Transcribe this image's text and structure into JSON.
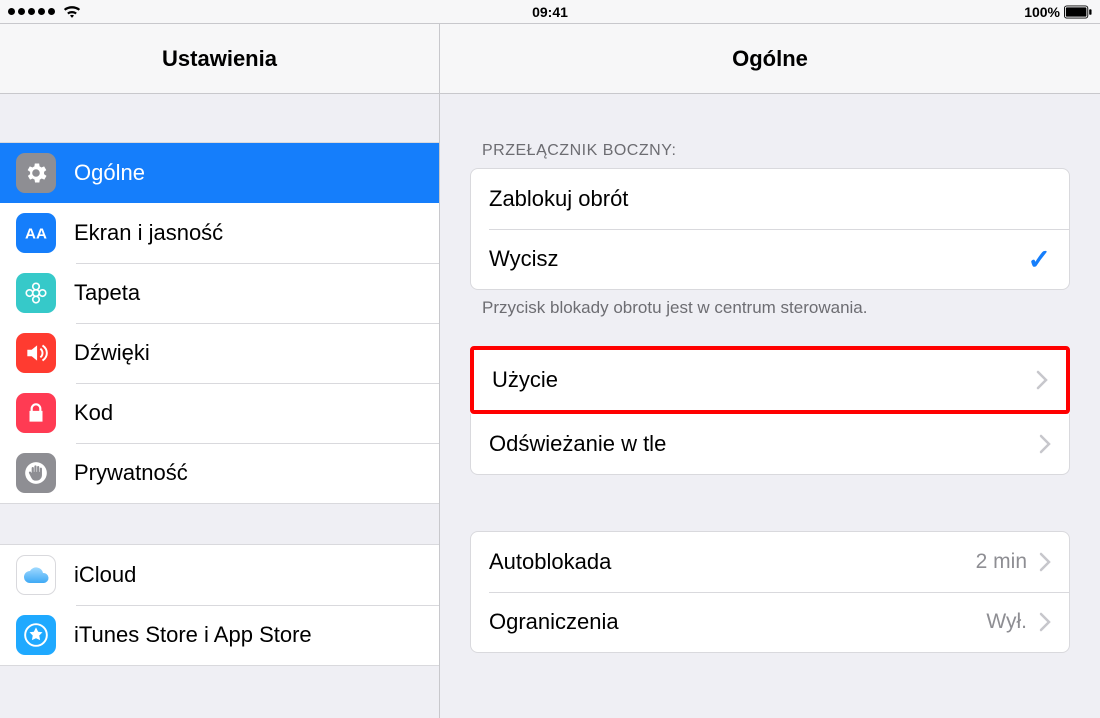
{
  "status": {
    "time": "09:41",
    "battery_pct": "100%"
  },
  "sidebar": {
    "title": "Ustawienia",
    "groups": [
      {
        "items": [
          {
            "label": "Ogólne",
            "icon": "gear",
            "icon_bg": "#8e8e93",
            "selected": true
          },
          {
            "label": "Ekran i jasność",
            "icon": "aa",
            "icon_bg": "#157efb"
          },
          {
            "label": "Tapeta",
            "icon": "flower",
            "icon_bg": "#36c9c9"
          },
          {
            "label": "Dźwięki",
            "icon": "speaker",
            "icon_bg": "#ff3b30"
          },
          {
            "label": "Kod",
            "icon": "lock",
            "icon_bg": "#ff3b53"
          },
          {
            "label": "Prywatność",
            "icon": "hand",
            "icon_bg": "#8e8e93"
          }
        ]
      },
      {
        "items": [
          {
            "label": "iCloud",
            "icon": "cloud",
            "icon_bg": "#ffffff"
          },
          {
            "label": "iTunes Store i App Store",
            "icon": "appstore",
            "icon_bg": "#1fa9ff"
          }
        ]
      }
    ]
  },
  "detail": {
    "title": "Ogólne",
    "switch_header": "Przełącznik boczny:",
    "switch_options": [
      {
        "label": "Zablokuj obrót",
        "checked": false
      },
      {
        "label": "Wycisz",
        "checked": true
      }
    ],
    "switch_footer": "Przycisk blokady obrotu jest w centrum sterowania.",
    "rows1": [
      {
        "label": "Użycie",
        "highlight": true
      },
      {
        "label": "Odświeżanie w tle"
      }
    ],
    "rows2": [
      {
        "label": "Autoblokada",
        "value": "2 min"
      },
      {
        "label": "Ograniczenia",
        "value": "Wył."
      }
    ]
  }
}
